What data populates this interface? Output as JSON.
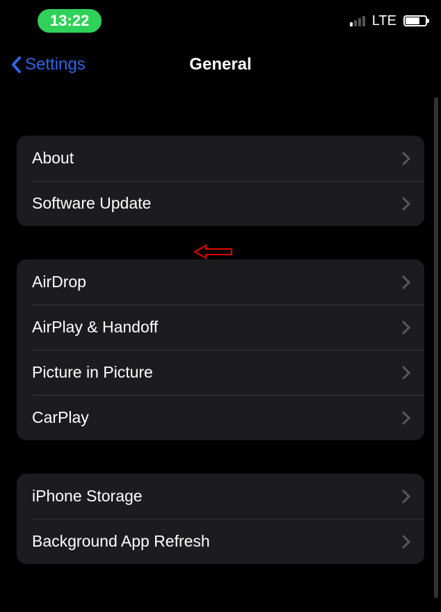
{
  "status": {
    "time": "13:22",
    "network": "LTE"
  },
  "nav": {
    "back_label": "Settings",
    "title": "General"
  },
  "groups": [
    {
      "rows": [
        {
          "label": "About"
        },
        {
          "label": "Software Update"
        }
      ]
    },
    {
      "rows": [
        {
          "label": "AirDrop"
        },
        {
          "label": "AirPlay & Handoff"
        },
        {
          "label": "Picture in Picture"
        },
        {
          "label": "CarPlay"
        }
      ]
    },
    {
      "rows": [
        {
          "label": "iPhone Storage"
        },
        {
          "label": "Background App Refresh"
        }
      ]
    }
  ]
}
